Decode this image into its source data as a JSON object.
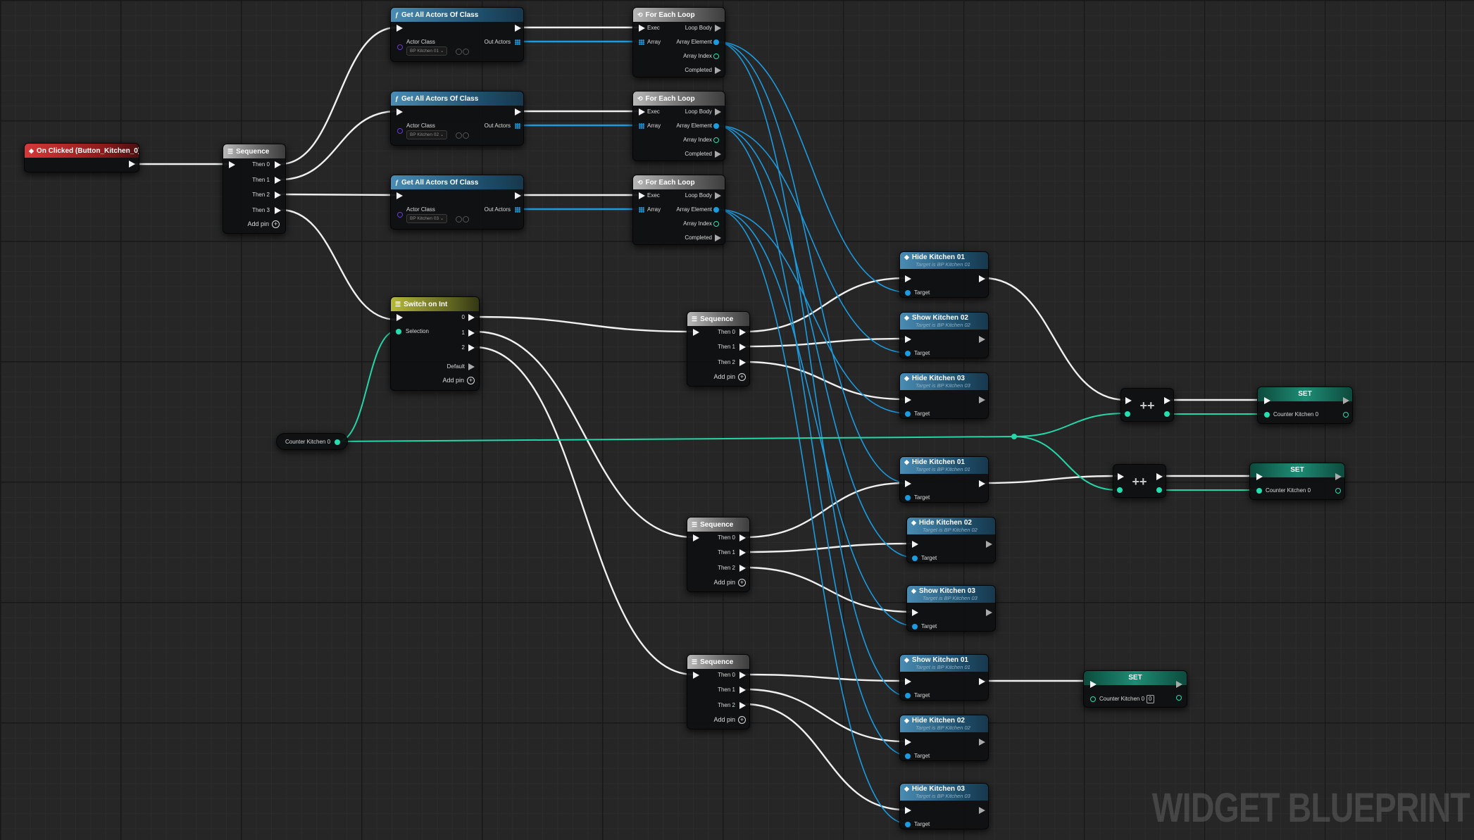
{
  "watermark": "WIDGET BLUEPRINT",
  "event_node": {
    "title": "On Clicked (Button_Kitchen_0)"
  },
  "seq_main": {
    "title": "Sequence",
    "pins": [
      "Then 0",
      "Then 1",
      "Then 2",
      "Then 3"
    ],
    "add_pin": "Add pin"
  },
  "get_actors": [
    {
      "title": "Get All Actors Of Class",
      "in_label": "Actor Class",
      "out_label": "Out Actors",
      "class_value": "BP Kitchen 01"
    },
    {
      "title": "Get All Actors Of Class",
      "in_label": "Actor Class",
      "out_label": "Out Actors",
      "class_value": "BP Kitchen 02"
    },
    {
      "title": "Get All Actors Of Class",
      "in_label": "Actor Class",
      "out_label": "Out Actors",
      "class_value": "BP Kitchen 03"
    }
  ],
  "loops": [
    {
      "title": "For Each Loop",
      "exec": "Exec",
      "array": "Array",
      "loop_body": "Loop Body",
      "element": "Array Element",
      "index": "Array Index",
      "completed": "Completed"
    },
    {
      "title": "For Each Loop",
      "exec": "Exec",
      "array": "Array",
      "loop_body": "Loop Body",
      "element": "Array Element",
      "index": "Array Index",
      "completed": "Completed"
    },
    {
      "title": "For Each Loop",
      "exec": "Exec",
      "array": "Array",
      "loop_body": "Loop Body",
      "element": "Array Element",
      "index": "Array Index",
      "completed": "Completed"
    }
  ],
  "switch_node": {
    "title": "Switch on Int",
    "selection": "Selection",
    "cases": [
      "0",
      "1",
      "2"
    ],
    "default": "Default",
    "add_pin": "Add pin"
  },
  "counter_var": {
    "label": "Counter Kitchen 0"
  },
  "sequences": [
    {
      "title": "Sequence",
      "pins": [
        "Then 0",
        "Then 1",
        "Then 2"
      ],
      "add_pin": "Add pin"
    },
    {
      "title": "Sequence",
      "pins": [
        "Then 0",
        "Then 1",
        "Then 2"
      ],
      "add_pin": "Add pin"
    },
    {
      "title": "Sequence",
      "pins": [
        "Then 0",
        "Then 1",
        "Then 2"
      ],
      "add_pin": "Add pin"
    }
  ],
  "func_nodes": [
    {
      "title": "Hide Kitchen 01",
      "sub": "Target is BP Kitchen 01",
      "target": "Target"
    },
    {
      "title": "Show Kitchen 02",
      "sub": "Target is BP Kitchen 02",
      "target": "Target"
    },
    {
      "title": "Hide Kitchen 03",
      "sub": "Target is BP Kitchen 03",
      "target": "Target"
    },
    {
      "title": "Hide Kitchen 01",
      "sub": "Target is BP Kitchen 01",
      "target": "Target"
    },
    {
      "title": "Hide Kitchen 02",
      "sub": "Target is BP Kitchen 02",
      "target": "Target"
    },
    {
      "title": "Show Kitchen 03",
      "sub": "Target is BP Kitchen 03",
      "target": "Target"
    },
    {
      "title": "Show Kitchen 01",
      "sub": "Target is BP Kitchen 01",
      "target": "Target"
    },
    {
      "title": "Hide Kitchen 02",
      "sub": "Target is BP Kitchen 02",
      "target": "Target"
    },
    {
      "title": "Hide Kitchen 03",
      "sub": "Target is BP Kitchen 03",
      "target": "Target"
    }
  ],
  "increment_nodes": [
    {
      "label": "++"
    },
    {
      "label": "++"
    }
  ],
  "set_nodes": [
    {
      "title": "SET",
      "var": "Counter Kitchen 0"
    },
    {
      "title": "SET",
      "var": "Counter Kitchen 0"
    },
    {
      "title": "SET",
      "var": "Counter Kitchen 0",
      "value": "0"
    }
  ]
}
